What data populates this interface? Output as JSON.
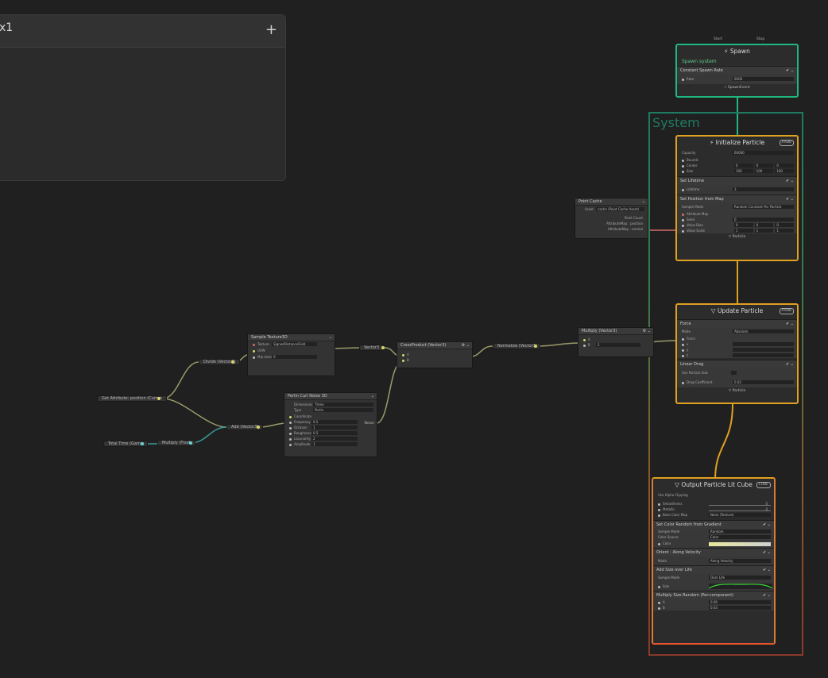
{
  "blackboard": {
    "title": "x1",
    "add_label": "+"
  },
  "frame": {
    "title": "System"
  },
  "spawn": {
    "flow_start": "Start",
    "flow_stop": "Stop",
    "title": "Spawn",
    "subtitle": "Spawn system",
    "block_title": "Constant Spawn Rate",
    "rate_label": "Rate",
    "rate_value": "6000",
    "out_label": "SpawnEvent"
  },
  "initialize": {
    "title": "Initialize Particle",
    "badge": "AABB",
    "capacity_label": "Capacity",
    "capacity_value": "60000",
    "bounds_label": "Bounds",
    "center_label": "Center",
    "size_label": "Size",
    "center": [
      "0",
      "0",
      "0"
    ],
    "size": [
      "100",
      "100",
      "100"
    ],
    "lifetime_block": "Set Lifetime",
    "lifetime_label": "Lifetime",
    "lifetime_value": "3",
    "posmap_block": "Set Position from Map",
    "sample_mode_label": "Sample Mode",
    "sample_mode_value": "Random Constant Per Particle",
    "attribute_map_label": "Attribute Map",
    "seed_label": "Seed",
    "seed_value": "0",
    "value_bias_label": "Value Bias",
    "value_scale_label": "Value Scale",
    "value_bias": [
      "0",
      "0",
      "0"
    ],
    "value_scale": [
      "1",
      "1",
      "1"
    ],
    "out_label": "Particle"
  },
  "update": {
    "title": "Update Particle",
    "badge": "AABB",
    "force_block": "Force",
    "mode_label": "Mode",
    "mode_value": "Absolute",
    "force_label": "Force",
    "x": "x",
    "y": "y",
    "z": "z",
    "drag_block": "Linear Drag",
    "use_particle_size_label": "Use Particle Size",
    "drag_coef_label": "Drag Coefficient",
    "drag_coef_value": "0.02",
    "out_label": "Particle"
  },
  "output": {
    "title": "Output Particle Lit Cube",
    "badge": "CUBE",
    "use_alpha_clipping": "Use Alpha Clipping",
    "smoothness_label": "Smoothness",
    "metallic_label": "Metallic",
    "base_color_map_label": "Base Color Map",
    "base_color_map_value": "None (Texture)",
    "smoothness_value": "0",
    "metallic_value": "0",
    "color_block": "Set Color Random from Gradient",
    "sample_mode_label": "Sample Mode",
    "sample_mode_value": "Random",
    "color_source_label": "Color Source",
    "color_source_value": "Color",
    "color_label": "Color",
    "orient_block": "Orient : Along Velocity",
    "mode_label": "Mode",
    "mode_value": "Along Velocity",
    "size_block": "Add Size over Life",
    "size_sample_mode_label": "Sample Mode",
    "size_sample_mode_value": "Over Life",
    "size_label": "Size",
    "mult_block": "Multiply Size Random (Per-component)",
    "a_label": "A",
    "b_label": "B",
    "a_value": "0.06",
    "b_value": "0.03",
    "accent_color": "#e0552e"
  },
  "point_cache": {
    "title": "Point Cache",
    "asset_label": "Asset",
    "asset_value": "cache (Point Cache Asset)",
    "point_count": "Point Count",
    "pos_label": "AttributeMap : position",
    "normal_label": "AttributeMap : normal"
  },
  "sample_texture": {
    "title": "Sample Texture3D",
    "texture_label": "Texture",
    "texture_value": "SignedDistanceField",
    "uvw_label": "UVW",
    "mip_label": "Mip Level",
    "mip_value": "0"
  },
  "curl": {
    "title": "Perlin Curl Noise 3D",
    "dimensions_label": "Dimensions",
    "dimensions_value": "Three",
    "type_label": "Type",
    "type_value": "Perlin",
    "coordinate_label": "Coordinate",
    "frequency_label": "Frequency",
    "frequency_value": "0.5",
    "octaves_label": "Octaves",
    "octaves_value": "1",
    "roughness_label": "Roughness",
    "roughness_value": "0.5",
    "lacunarity_label": "Lacunarity",
    "lacunarity_value": "2",
    "amplitude_label": "Amplitude",
    "amplitude_value": "1",
    "out_label": "Noise"
  },
  "cross": {
    "title": "CrossProduct (Vector3)",
    "a": "A",
    "b": "B"
  },
  "multiply_v3": {
    "title": "Multiply (Vector3)",
    "a": "A",
    "b": "B",
    "b_value": "5"
  },
  "pills": {
    "get_attribute": "Get Attribute: position (Curren",
    "divide": "Divide (Vector3)",
    "add": "Add (Vector3)",
    "total_time": "Total Time (Game",
    "multiply_float": "Multiply (Float",
    "vector3": "Vector3",
    "normalize": "Normalize (Vector3"
  },
  "colors": {
    "spawn": "#20b880",
    "initialize": "#e0a020",
    "update": "#e0a020",
    "output_border": "#e0a020",
    "wire_operator": "#b0b07a",
    "wire_time": "#3a9a9a",
    "wire_flow": "#e0a020",
    "wire_spawn": "#20b880"
  }
}
